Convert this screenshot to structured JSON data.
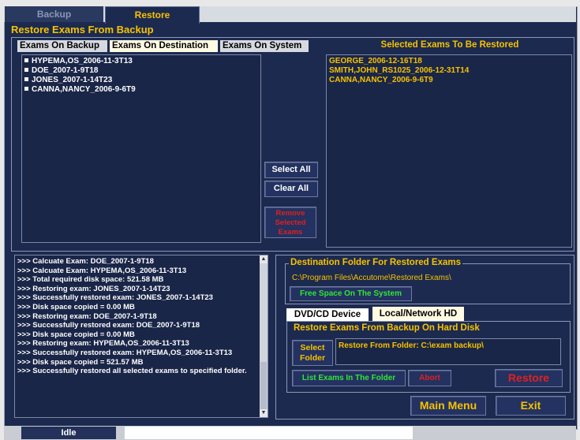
{
  "tabs": {
    "backup": "Backup",
    "restore": "Restore"
  },
  "restore_title": "Restore Exams From Backup",
  "subtabs": [
    "Exams On Backup",
    "Exams On Destination",
    "Exams On System"
  ],
  "exam_list": [
    "HYPEMA,OS_2006-11-3T13",
    "DOE_2007-1-9T18",
    "JONES_2007-1-14T23",
    "CANNA,NANCY_2006-9-6T9"
  ],
  "buttons": {
    "select_all": "Select All",
    "clear_all": "Clear All",
    "remove_selected": "Remove Selected Exams",
    "free_space": "Free Space On The System",
    "select_folder": "Select Folder",
    "list_exams": "List Exams In The Folder",
    "abort": "Abort",
    "restore": "Restore",
    "main_menu": "Main Menu",
    "exit": "Exit"
  },
  "selected_title": "Selected Exams To Be Restored",
  "selected_exams": [
    "GEORGE_2006-12-16T18",
    "SMITH,JOHN_RS1025_2006-12-31T14",
    "CANNA,NANCY_2006-9-6T9"
  ],
  "log": [
    ">>> Calcuate Exam: DOE_2007-1-9T18",
    ">>> Calcuate Exam: HYPEMA,OS_2006-11-3T13",
    ">>> Total required disk space: 521.58 MB",
    ">>> Restoring exam: JONES_2007-1-14T23",
    ">>> Successfully restored exam: JONES_2007-1-14T23",
    ">>> Disk space copied = 0.00 MB",
    ">>> Restoring exam: DOE_2007-1-9T18",
    ">>> Successfully restored exam: DOE_2007-1-9T18",
    ">>> Disk space copied = 0.00 MB",
    ">>> Restoring exam: HYPEMA,OS_2006-11-3T13",
    ">>> Successfully restored exam: HYPEMA,OS_2006-11-3T13",
    ">>> Disk space copied = 521.57 MB",
    ">>> Successfully restored all selected exams to specified folder."
  ],
  "destination": {
    "title": "Destination Folder For Restored Exams",
    "path": "C:\\Program Files\\Accutome\\Restored Exams\\"
  },
  "device_tabs": [
    "DVD/CD Device",
    "Local/Network HD"
  ],
  "hd": {
    "title": "Restore Exams From Backup On Hard Disk",
    "folder_text": "Restore From Folder: C:\\exam backup\\"
  },
  "status": {
    "text": "Idle"
  },
  "colors": {
    "background": "#1c2a4f",
    "accent_yellow": "#f7c200",
    "green_text": "#34e33a",
    "red_text": "#e02020"
  }
}
